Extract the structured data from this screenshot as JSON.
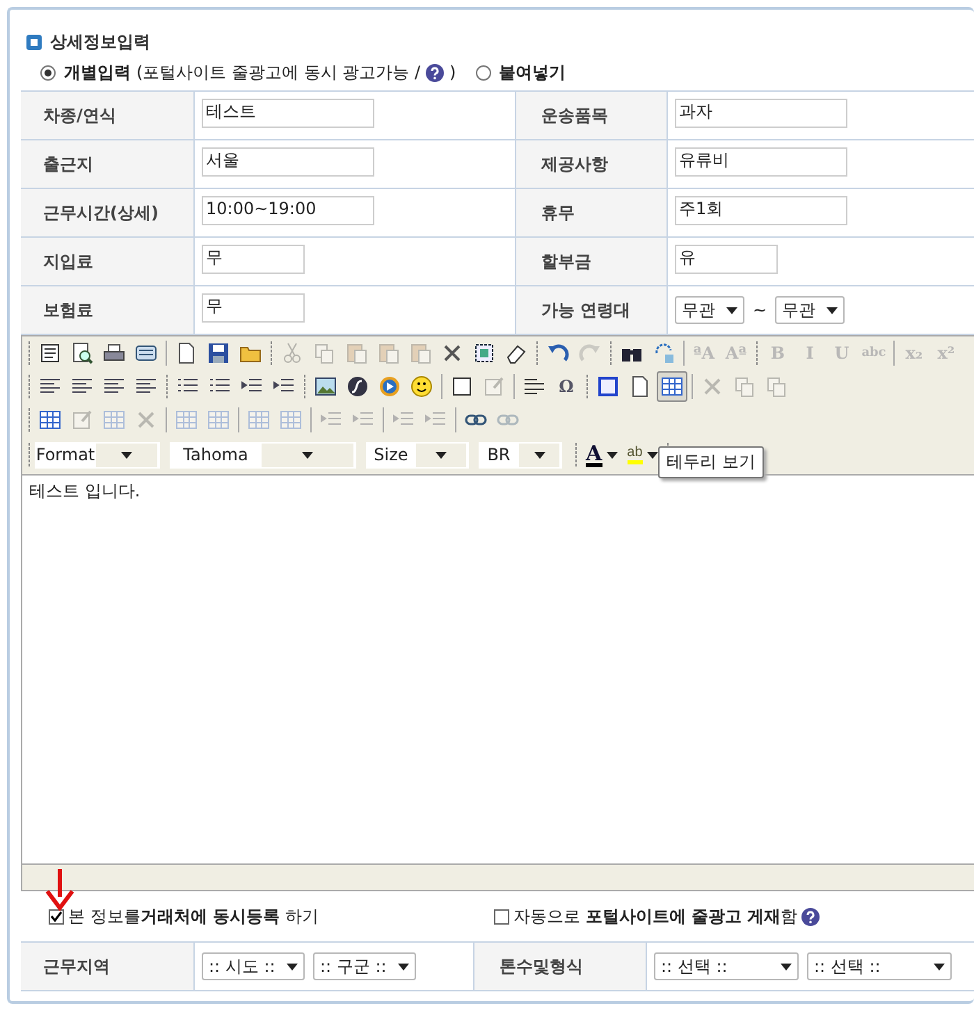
{
  "section_title": "상세정보입력",
  "mode_options": [
    {
      "label": "개별입력",
      "note_before": "(포털사이트 줄광고에 동시 광고가능 /",
      "help": true,
      "note_after": ")",
      "selected": true
    },
    {
      "label": "붙여넣기",
      "selected": false
    }
  ],
  "detail_rows": [
    [
      {
        "label": "차종/연식",
        "kind": "text",
        "value": "테스트"
      },
      {
        "label": "운송품목",
        "kind": "text",
        "value": "과자"
      }
    ],
    [
      {
        "label": "출근지",
        "kind": "text",
        "value": "서울"
      },
      {
        "label": "제공사항",
        "kind": "text",
        "value": "유류비"
      }
    ],
    [
      {
        "label": "근무시간(상세)",
        "kind": "text",
        "value": "10:00~19:00"
      },
      {
        "label": "휴무",
        "kind": "text",
        "value": "주1회"
      }
    ],
    [
      {
        "label": "지입료",
        "kind": "short_text",
        "value": "무"
      },
      {
        "label": "할부금",
        "kind": "short_text",
        "value": "유"
      }
    ],
    [
      {
        "label": "보험료",
        "kind": "short_text",
        "value": "무"
      },
      {
        "label": "가능 연령대",
        "kind": "range",
        "from": "무관",
        "separator": "~",
        "to": "무관"
      }
    ]
  ],
  "editor": {
    "toolbar_rows": [
      [
        {
          "kind": "source"
        },
        {
          "kind": "preview"
        },
        {
          "kind": "printer"
        },
        {
          "kind": "stack"
        },
        {
          "kind": "bar"
        },
        {
          "kind": "page"
        },
        {
          "kind": "save"
        },
        {
          "kind": "folder"
        },
        {
          "kind": "grip"
        },
        {
          "kind": "scissors",
          "disabled": true
        },
        {
          "kind": "copy",
          "disabled": true
        },
        {
          "kind": "paste",
          "disabled": true
        },
        {
          "kind": "paste",
          "disabled": true
        },
        {
          "kind": "paste",
          "disabled": true
        },
        {
          "kind": "cross",
          "disabled": false
        },
        {
          "kind": "select"
        },
        {
          "kind": "eraser"
        },
        {
          "kind": "grip"
        },
        {
          "kind": "undo"
        },
        {
          "kind": "redo",
          "disabled": true
        },
        {
          "kind": "grip"
        },
        {
          "kind": "binoculars"
        },
        {
          "kind": "replace"
        },
        {
          "kind": "bar"
        },
        {
          "kind": "glyph",
          "label": "ªA",
          "disabled": true
        },
        {
          "kind": "glyph",
          "label": "Aª",
          "disabled": true
        },
        {
          "kind": "grip"
        },
        {
          "kind": "glyph",
          "label": "B",
          "disabled": true
        },
        {
          "kind": "glyph",
          "label": "I",
          "disabled": true
        },
        {
          "kind": "glyph",
          "label": "U",
          "disabled": true
        },
        {
          "kind": "glyph",
          "label": "abc",
          "disabled": true
        },
        {
          "kind": "bar"
        },
        {
          "kind": "glyph",
          "label": "x₂",
          "disabled": true
        },
        {
          "kind": "glyph",
          "label": "x²",
          "disabled": true
        }
      ],
      [
        {
          "kind": "align"
        },
        {
          "kind": "align"
        },
        {
          "kind": "align"
        },
        {
          "kind": "align"
        },
        {
          "kind": "grip"
        },
        {
          "kind": "list"
        },
        {
          "kind": "list"
        },
        {
          "kind": "indent"
        },
        {
          "kind": "indent"
        },
        {
          "kind": "grip"
        },
        {
          "kind": "image"
        },
        {
          "kind": "flash"
        },
        {
          "kind": "play"
        },
        {
          "kind": "smiley"
        },
        {
          "kind": "bar"
        },
        {
          "kind": "square"
        },
        {
          "kind": "pencil",
          "disabled": true
        },
        {
          "kind": "bar"
        },
        {
          "kind": "rule"
        },
        {
          "kind": "glyph",
          "label": "Ω"
        },
        {
          "kind": "grip"
        },
        {
          "kind": "frame"
        },
        {
          "kind": "page"
        },
        {
          "kind": "grid",
          "selected": true
        },
        {
          "kind": "bar"
        },
        {
          "kind": "cross",
          "disabled": true
        },
        {
          "kind": "copy",
          "disabled": true
        },
        {
          "kind": "copy",
          "disabled": true
        }
      ],
      [
        {
          "kind": "grid"
        },
        {
          "kind": "pencil",
          "disabled": true
        },
        {
          "kind": "grid",
          "disabled": true
        },
        {
          "kind": "cross",
          "disabled": true
        },
        {
          "kind": "bar"
        },
        {
          "kind": "grid",
          "disabled": true
        },
        {
          "kind": "grid",
          "disabled": true
        },
        {
          "kind": "bar"
        },
        {
          "kind": "grid",
          "disabled": true
        },
        {
          "kind": "grid",
          "disabled": true
        },
        {
          "kind": "bar"
        },
        {
          "kind": "indent",
          "disabled": true
        },
        {
          "kind": "indent",
          "disabled": true
        },
        {
          "kind": "bar"
        },
        {
          "kind": "indent",
          "disabled": true
        },
        {
          "kind": "indent",
          "disabled": true
        },
        {
          "kind": "bar"
        },
        {
          "kind": "link"
        },
        {
          "kind": "link",
          "disabled": true
        }
      ]
    ],
    "format_dropdowns": [
      "Format",
      "Tahoma",
      "Size",
      "BR"
    ],
    "color_buttons": [
      {
        "kind": "text_color",
        "label": "A"
      },
      {
        "kind": "highlight",
        "label": "ab"
      }
    ],
    "tooltip": "테두리 보기",
    "content": "테스트 입니다."
  },
  "share_options": [
    {
      "text": "본 정보를**거래처에 동시등록** 하기",
      "checked": true,
      "help": false
    },
    {
      "text": "자동으로 **포털사이트에 줄광고 게재**함",
      "checked": false,
      "help": true
    }
  ],
  "bottom_row": [
    {
      "label": "근무지역",
      "selects": [
        ":: 시도 ::",
        ":: 구군 ::"
      ]
    },
    {
      "label": "톤수및형식",
      "selects": [
        ":: 선택 ::",
        ":: 선택 ::"
      ]
    }
  ]
}
